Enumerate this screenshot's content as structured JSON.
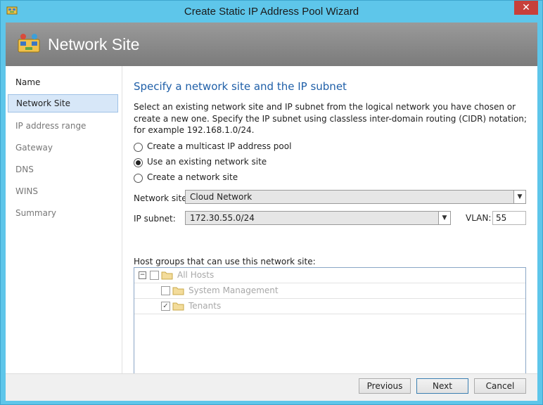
{
  "window": {
    "title": "Create Static IP Address Pool Wizard",
    "close_glyph": "✕"
  },
  "banner": {
    "title": "Network Site",
    "icon": "network-site-icon"
  },
  "nav": {
    "items": [
      {
        "label": "Name"
      },
      {
        "label": "Network Site"
      },
      {
        "label": "IP address range"
      },
      {
        "label": "Gateway"
      },
      {
        "label": "DNS"
      },
      {
        "label": "WINS"
      },
      {
        "label": "Summary"
      }
    ],
    "active_index": 1
  },
  "main": {
    "heading": "Specify a network site and the IP subnet",
    "description": "Select an existing network site and IP subnet from the logical network you have chosen or create a new one. Specify the IP subnet using classless inter-domain routing (CIDR) notation; for example 192.168.1.0/24.",
    "options": [
      {
        "label": "Create a multicast IP address pool",
        "selected": false
      },
      {
        "label": "Use an existing network site",
        "selected": true
      },
      {
        "label": "Create a network site",
        "selected": false
      }
    ],
    "network_site": {
      "label": "Network site:",
      "value": "Cloud Network"
    },
    "ip_subnet": {
      "label": "IP subnet:",
      "value": "172.30.55.0/24"
    },
    "vlan": {
      "label": "VLAN:",
      "value": "55"
    },
    "host_groups": {
      "label": "Host groups that can use this network site:",
      "tree": [
        {
          "label": "All Hosts",
          "checked": false,
          "expander": "−"
        },
        {
          "label": "System Management",
          "checked": false
        },
        {
          "label": "Tenants",
          "checked": true
        }
      ]
    }
  },
  "footer": {
    "previous": "Previous",
    "next": "Next",
    "cancel": "Cancel"
  },
  "colors": {
    "titlebar": "#5ec6ea",
    "heading": "#1f5fa8",
    "close": "#c7403a",
    "nav_active": "#d7e7f8"
  }
}
